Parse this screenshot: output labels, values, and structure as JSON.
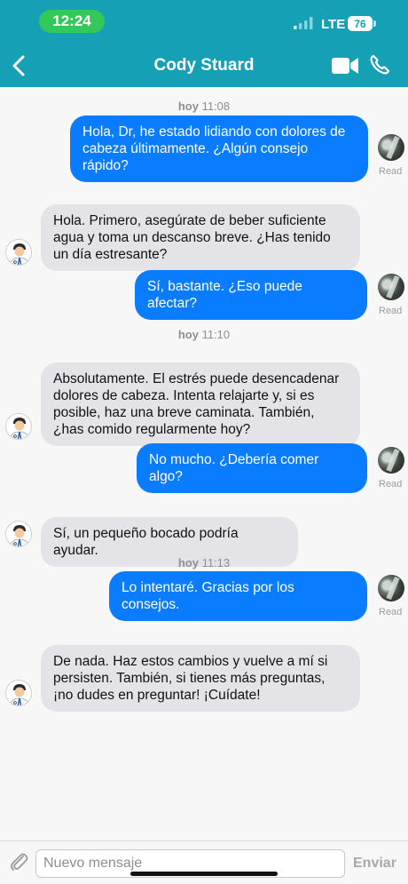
{
  "status_bar": {
    "time": "12:24",
    "network": "LTE",
    "battery": "76"
  },
  "header": {
    "title": "Cody Stuard"
  },
  "timestamps": [
    {
      "day": "hoy",
      "time": "11:08"
    },
    {
      "day": "hoy",
      "time": "11:10"
    },
    {
      "day": "hoy",
      "time": "11:13"
    }
  ],
  "messages": [
    {
      "from": "user",
      "text": "Hola, Dr, he estado lidiando con dolores de cabeza últimamente. ¿Algún consejo rápido?",
      "status": "Read"
    },
    {
      "from": "doctor",
      "text": "Hola. Primero, asegúrate de beber suficiente agua y toma un descanso breve. ¿Has tenido un día estresante?"
    },
    {
      "from": "user",
      "text": "Sí, bastante. ¿Eso puede afectar?",
      "status": "Read"
    },
    {
      "from": "doctor",
      "text": "Absolutamente. El estrés puede desencadenar dolores de cabeza. Intenta relajarte y, si es posible, haz una breve caminata. También, ¿has comido regularmente hoy?"
    },
    {
      "from": "user",
      "text": "No mucho. ¿Debería comer algo?",
      "status": "Read"
    },
    {
      "from": "doctor",
      "text": "Sí, un pequeño bocado podría ayudar."
    },
    {
      "from": "user",
      "text": "Lo intentaré. Gracias por los consejos.",
      "status": "Read"
    },
    {
      "from": "doctor",
      "text": "De nada. Haz estos cambios y vuelve a mí si persisten. También, si tienes más preguntas, ¡no dudes en preguntar! ¡Cuídate!"
    }
  ],
  "composer": {
    "placeholder": "Nuevo mensaje",
    "send_label": "Enviar"
  },
  "colors": {
    "header": "#16a0b6",
    "outgoing": "#0a7cff",
    "incoming": "#e4e4e8"
  }
}
